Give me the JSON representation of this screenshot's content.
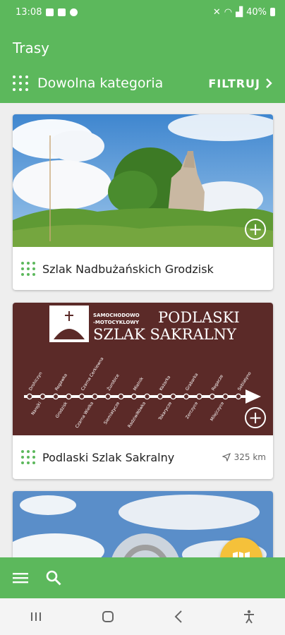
{
  "status_bar": {
    "time": "13:08",
    "battery": "40%"
  },
  "header": {
    "title": "Trasy",
    "category_label": "Dowolna kategoria",
    "filter_label": "FILTRUJ"
  },
  "routes": [
    {
      "title": "Szlak Nadbużańskich Grodzisk",
      "distance": ""
    },
    {
      "title": "Podlaski Szlak Sakralny",
      "distance": "325 km",
      "image": {
        "heading_top": "SAMOCHODOWO",
        "heading_mid": "-MOTOCYKLOWY",
        "heading_big1": "PODLASKI",
        "heading_big2": "SZLAK SAKRALNY",
        "stops_top": [
          "Drohiczyn",
          "Rogawka",
          "Czarna Cerkiewna",
          "Żurobice",
          "Mielnik",
          "Kożarka",
          "Grabarka",
          "Rogacze",
          "Sobiatyno"
        ],
        "stops_bottom": [
          "Narojki",
          "Grodzisk",
          "Czarna Wielka",
          "Siemiatycze",
          "Radziwiłłówka",
          "Tokarycze",
          "Zerczyce",
          "Milejczyce"
        ]
      }
    },
    {
      "title": "",
      "distance": ""
    }
  ],
  "colors": {
    "primary": "#5cb85c",
    "fab": "#f5c13a",
    "sakral_bg": "#5b2a28"
  }
}
